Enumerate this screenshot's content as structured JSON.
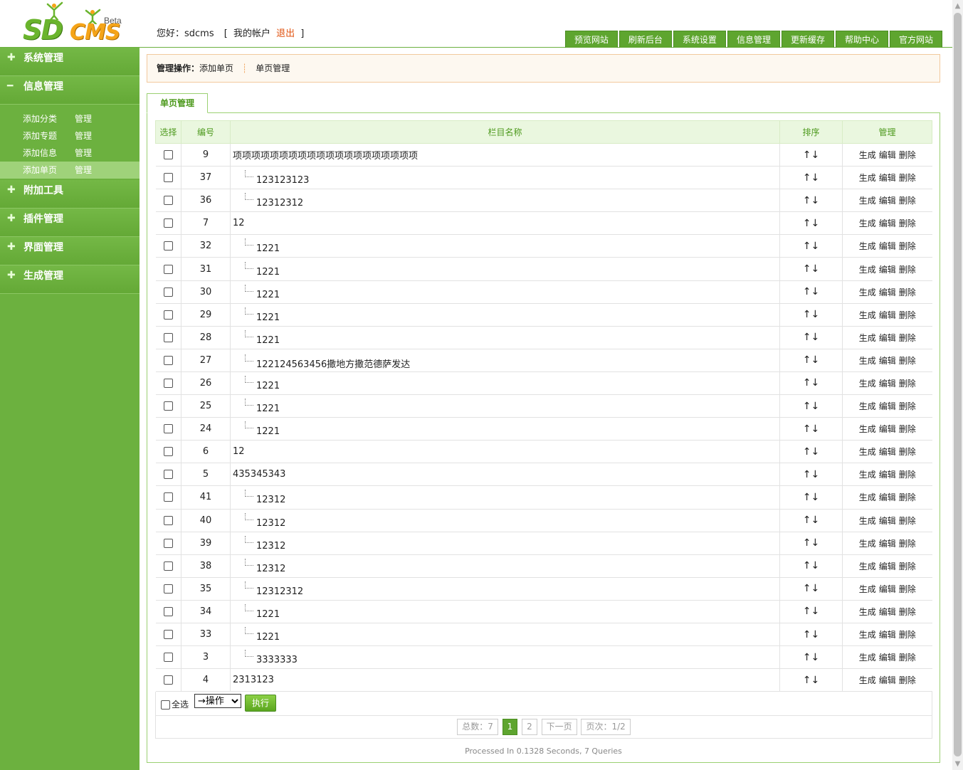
{
  "header": {
    "logo": {
      "sd": "SD",
      "cms": "CMS",
      "beta": "Beta"
    },
    "greeting": "您好：sdcms",
    "account_label": "我的帐户",
    "logout_label": "退出",
    "bracket_open": "[",
    "bracket_close": "]",
    "nav": [
      "预览网站",
      "刷新后台",
      "系统设置",
      "信息管理",
      "更新缓存",
      "帮助中心",
      "官方网站"
    ]
  },
  "sidebar": {
    "menus": [
      {
        "icon": "plus-icon",
        "symbol": "✚",
        "label": "系统管理"
      },
      {
        "icon": "minus-icon",
        "symbol": "━",
        "label": "信息管理"
      },
      {
        "icon": "plus-icon",
        "symbol": "✚",
        "label": "附加工具"
      },
      {
        "icon": "plus-icon",
        "symbol": "✚",
        "label": "插件管理"
      },
      {
        "icon": "plus-icon",
        "symbol": "✚",
        "label": "界面管理"
      },
      {
        "icon": "plus-icon",
        "symbol": "✚",
        "label": "生成管理"
      }
    ],
    "submenu": [
      {
        "add": "添加分类",
        "manage": "管理"
      },
      {
        "add": "添加专题",
        "manage": "管理"
      },
      {
        "add": "添加信息",
        "manage": "管理"
      },
      {
        "add": "添加单页",
        "manage": "管理"
      }
    ]
  },
  "opbar": {
    "label": "管理操作：",
    "add": "添加单页",
    "divider": "┊",
    "manage": "单页管理"
  },
  "tab": {
    "label": "单页管理"
  },
  "table": {
    "headers": [
      "选择",
      "编号",
      "栏目名称",
      "排序",
      "管理"
    ],
    "sort_symbol": "↑↓",
    "actions": [
      "生成",
      "编辑",
      "删除"
    ],
    "rows": [
      {
        "id": "9",
        "name": "项项项项项项项项项项项项项项项项项项项项",
        "child": false
      },
      {
        "id": "37",
        "name": "123123123",
        "child": true
      },
      {
        "id": "36",
        "name": "12312312",
        "child": true
      },
      {
        "id": "7",
        "name": "12",
        "child": false
      },
      {
        "id": "32",
        "name": "1221",
        "child": true
      },
      {
        "id": "31",
        "name": "1221",
        "child": true
      },
      {
        "id": "30",
        "name": "1221",
        "child": true
      },
      {
        "id": "29",
        "name": "1221",
        "child": true
      },
      {
        "id": "28",
        "name": "1221",
        "child": true
      },
      {
        "id": "27",
        "name": "122124563456撒地方撒范德萨发达",
        "child": true
      },
      {
        "id": "26",
        "name": "1221",
        "child": true
      },
      {
        "id": "25",
        "name": "1221",
        "child": true
      },
      {
        "id": "24",
        "name": "1221",
        "child": true
      },
      {
        "id": "6",
        "name": "12",
        "child": false
      },
      {
        "id": "5",
        "name": "435345343",
        "child": false
      },
      {
        "id": "41",
        "name": "12312",
        "child": true
      },
      {
        "id": "40",
        "name": "12312",
        "child": true
      },
      {
        "id": "39",
        "name": "12312",
        "child": true
      },
      {
        "id": "38",
        "name": "12312",
        "child": true
      },
      {
        "id": "35",
        "name": "12312312",
        "child": true
      },
      {
        "id": "34",
        "name": "1221",
        "child": true
      },
      {
        "id": "33",
        "name": "1221",
        "child": true
      },
      {
        "id": "3",
        "name": "3333333",
        "child": true
      },
      {
        "id": "4",
        "name": "2313123",
        "child": false
      }
    ]
  },
  "bottom": {
    "select_all": "全选",
    "operation_selected": "→操作",
    "run_label": "执行"
  },
  "pager": {
    "total": "总数：7",
    "page1": "1",
    "page2": "2",
    "next": "下一页",
    "pages": "页次：1/2"
  },
  "footer": "Processed In 0.1328 Seconds, 7 Queries",
  "colors": {
    "brand_green": "#6cb13f",
    "nav_green": "#5ea52f",
    "logout_orange": "#e0520f",
    "logo_orange": "#f5a418"
  }
}
